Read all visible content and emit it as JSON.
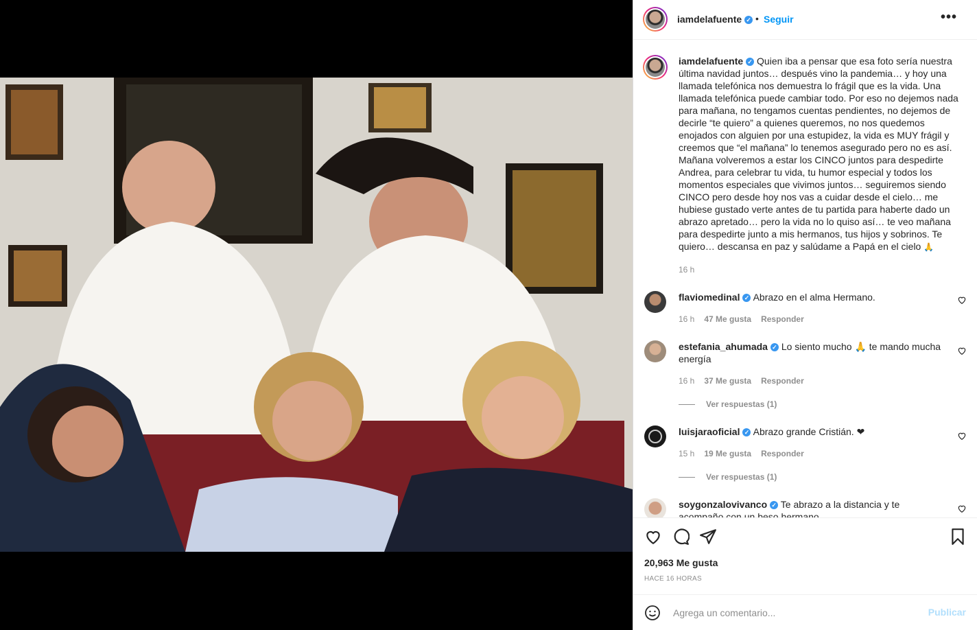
{
  "post": {
    "author": "iamdelafuente",
    "follow_label": "Seguir",
    "dot": "•",
    "more_label": "•••",
    "caption": "Quien iba a pensar que esa foto sería nuestra última navidad juntos… después vino la pandemia… y hoy una llamada telefónica nos demuestra lo frágil que es la vida. Una llamada telefónica puede cambiar todo. Por eso no dejemos nada para mañana, no tengamos cuentas pendientes, no dejemos de decirle “te quiero” a quienes queremos, no nos quedemos enojados con alguien por una estupidez, la vida es MUY frágil y creemos que “el mañana” lo tenemos asegurado pero no es así. Mañana volveremos a estar los CINCO juntos para despedirte Andrea, para celebrar tu vida, tu humor especial y todos los momentos especiales que vivimos juntos… seguiremos siendo CINCO pero desde hoy nos vas a cuidar desde el cielo… me hubiese gustado verte antes de tu partida para haberte dado un abrazo apretado… pero la vida no lo quiso así… te veo mañana para despedirte junto a mis hermanos, tus hijos y sobrinos. Te quiero… descansa en paz y salúdame a Papá en el cielo",
    "caption_emoji": "🙏",
    "caption_time": "16 h",
    "likes": "20,963 Me gusta",
    "posted_ago": "HACE 16 HORAS"
  },
  "comments": [
    {
      "user": "flaviomedinal",
      "text": "Abrazo en el alma Hermano.",
      "time": "16 h",
      "likes": "47 Me gusta",
      "reply": "Responder",
      "view_replies": ""
    },
    {
      "user": "estefania_ahumada",
      "text": "Lo siento mucho 🙏 te mando mucha energía",
      "time": "16 h",
      "likes": "37 Me gusta",
      "reply": "Responder",
      "view_replies": "Ver respuestas (1)"
    },
    {
      "user": "luisjaraoficial",
      "text": "Abrazo grande Cristián. ❤",
      "time": "15 h",
      "likes": "19 Me gusta",
      "reply": "Responder",
      "view_replies": "Ver respuestas (1)"
    },
    {
      "user": "soygonzalovivanco",
      "text": "Te abrazo a la distancia y te acompaño con un beso hermano",
      "time": "",
      "likes": "",
      "reply": "",
      "view_replies": ""
    }
  ],
  "composer": {
    "placeholder": "Agrega un comentario...",
    "publish_label": "Publicar"
  },
  "icons": {
    "verified": "verified-badge-icon",
    "like": "heart-icon",
    "comment": "comment-bubble-icon",
    "share": "paper-plane-icon",
    "save": "bookmark-icon",
    "emoji": "smiley-icon"
  },
  "colors": {
    "accent": "#0095f6",
    "verified": "#3897f0",
    "muted": "#8e8e8e",
    "publish_disabled": "#b2dffc"
  }
}
